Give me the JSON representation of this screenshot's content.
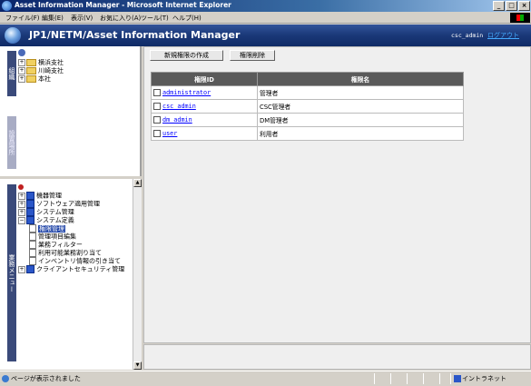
{
  "window": {
    "title": "Asset Information Manager - Microsoft Internet Explorer",
    "min_label": "_",
    "max_label": "□",
    "close_label": "×"
  },
  "menubar": [
    "ファイル(F)",
    "編集(E)",
    "表示(V)",
    "お気に入り(A)",
    "ツール(T)",
    "ヘルプ(H)"
  ],
  "app": {
    "title": "JP1/NETM/Asset Information Manager",
    "user": "csc_admin",
    "logout": "ログアウト"
  },
  "sidebar_tabs": {
    "org": "組織",
    "location": "設置場所",
    "menu": "業務メニュー"
  },
  "org_tree": [
    "横浜支社",
    "川崎支社",
    "本社"
  ],
  "menu_tree": [
    {
      "label": "機器管理",
      "type": "book",
      "expander": "+"
    },
    {
      "label": "ソフトウェア適用管理",
      "type": "book",
      "expander": "+"
    },
    {
      "label": "システム管理",
      "type": "book",
      "expander": "+"
    },
    {
      "label": "システム定義",
      "type": "book",
      "expander": "−"
    },
    {
      "label": "権限管理",
      "type": "page",
      "selected": true
    },
    {
      "label": "管理項目編集",
      "type": "page"
    },
    {
      "label": "業務フィルター",
      "type": "page"
    },
    {
      "label": "利用可能業務割り当て",
      "type": "page"
    },
    {
      "label": "インベントリ情報の引き当て",
      "type": "page"
    },
    {
      "label": "クライアントセキュリティ管理",
      "type": "book",
      "expander": "+"
    }
  ],
  "toolbar": {
    "create_label": "新規権限の作成",
    "delete_label": "権限削除"
  },
  "table": {
    "headers": [
      "権限ID",
      "権限名"
    ],
    "rows": [
      {
        "id": "administrator",
        "name": "管理者"
      },
      {
        "id": "csc_admin",
        "name": "CSC管理者"
      },
      {
        "id": "dm_admin",
        "name": "DM管理者"
      },
      {
        "id": "user",
        "name": "利用者"
      }
    ]
  },
  "status": {
    "text": "ページが表示されました",
    "zone": "イントラネット"
  }
}
